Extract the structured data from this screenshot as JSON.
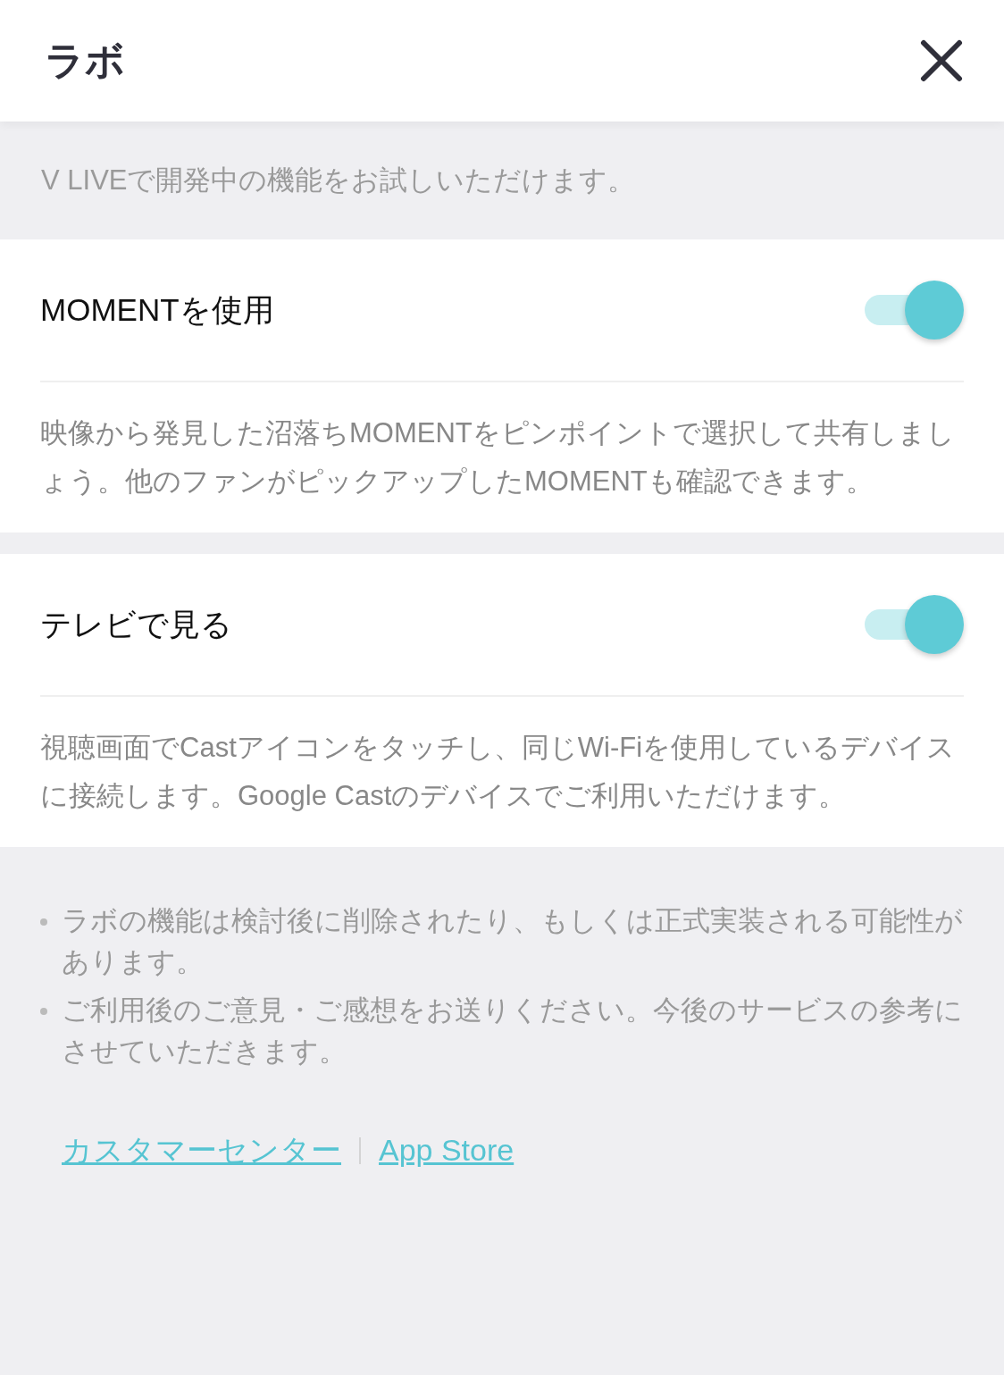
{
  "header": {
    "title": "ラボ"
  },
  "intro": "V LIVEで開発中の機能をお試しいただけます。",
  "features": [
    {
      "label": "MOMENTを使用",
      "on": true,
      "description": "映像から発見した沼落ちMOMENTをピンポイントで選択して共有しましょう。他のファンがピックアップしたMOMENTも確認できます。"
    },
    {
      "label": "テレビで見る",
      "on": true,
      "description": "視聴画面でCastアイコンをタッチし、同じWi-Fiを使用しているデバイスに接続します。Google Castのデバイスでご利用いただけます。"
    }
  ],
  "notes": [
    "ラボの機能は検討後に削除されたり、もしくは正式実装される可能性があります。",
    "ご利用後のご意見・ご感想をお送りください。今後のサービスの参考にさせていただきます。"
  ],
  "links": [
    "カスタマーセンター",
    "App Store"
  ]
}
